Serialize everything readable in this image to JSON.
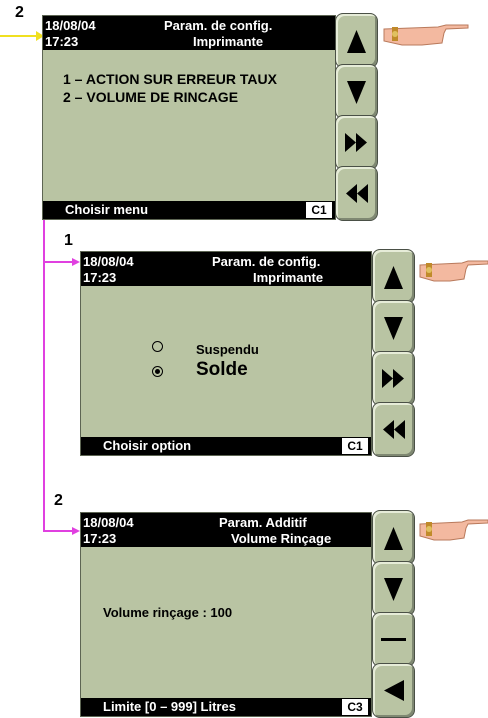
{
  "steps": {
    "top": "2",
    "middle": "1",
    "bottom": "2"
  },
  "screen1": {
    "date": "18/08/04",
    "time": "17:23",
    "title": "Param. de config.",
    "subtitle": "Imprimante",
    "menu": [
      "1 – ACTION SUR ERREUR TAUX",
      "2 – VOLUME DE RINCAGE"
    ],
    "footer": "Choisir  menu",
    "code": "C1"
  },
  "screen2": {
    "date": "18/08/04",
    "time": "17:23",
    "title": "Param. de config.",
    "subtitle": "Imprimante",
    "options": [
      {
        "label": "Suspendu",
        "selected": false
      },
      {
        "label": "Solde",
        "selected": true
      }
    ],
    "footer": "Choisir option",
    "code": "C1"
  },
  "screen3": {
    "date": "18/08/04",
    "time": "17:23",
    "title": "Param. Additif",
    "subtitle": "Volume Rinçage",
    "field_label": "Volume rinçage  : 100",
    "footer": "Limite [0 – 999] Litres",
    "code": "C3"
  },
  "buttons1": [
    "arrow-up",
    "arrow-down",
    "fast-forward",
    "rewind"
  ],
  "buttons2": [
    "arrow-up",
    "arrow-down",
    "fast-forward",
    "rewind"
  ],
  "buttons3": [
    "arrow-up",
    "arrow-down",
    "minus",
    "arrow-left"
  ],
  "colors": {
    "screen": "#b9c4a3",
    "connector": "#e040e0",
    "pointer": "#f0e020"
  }
}
